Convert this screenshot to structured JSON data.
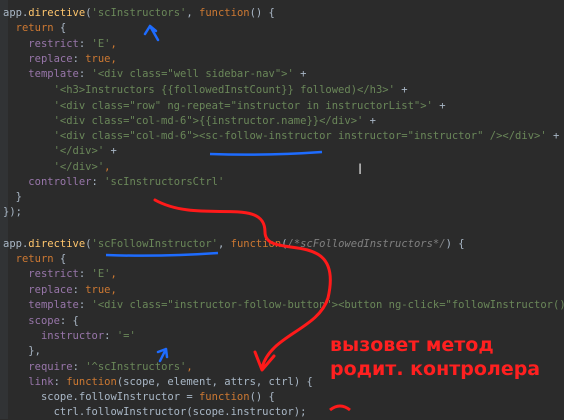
{
  "code_lines": [
    {
      "parts": [
        [
          "app.",
          "plain"
        ],
        [
          "directive",
          "fn"
        ],
        [
          "(",
          "plain"
        ],
        [
          "'scInstructors'",
          "str"
        ],
        [
          ", ",
          "plain"
        ],
        [
          "function",
          "kw"
        ],
        [
          "() {",
          "plain"
        ]
      ]
    },
    {
      "parts": [
        [
          "  ",
          "plain"
        ],
        [
          "return",
          "kw"
        ],
        [
          " {",
          "plain"
        ]
      ]
    },
    {
      "parts": [
        [
          "    ",
          "plain"
        ],
        [
          "restrict",
          "prop"
        ],
        [
          ": ",
          "plain"
        ],
        [
          "'E'",
          "str"
        ],
        [
          ",",
          "kw"
        ]
      ]
    },
    {
      "parts": [
        [
          "    ",
          "plain"
        ],
        [
          "replace",
          "prop"
        ],
        [
          ": ",
          "plain"
        ],
        [
          "true",
          "kw"
        ],
        [
          ",",
          "kw"
        ]
      ]
    },
    {
      "parts": [
        [
          "    ",
          "plain"
        ],
        [
          "template",
          "prop"
        ],
        [
          ": ",
          "plain"
        ],
        [
          "'<div class=\"well sidebar-nav\">'",
          "str"
        ],
        [
          " +",
          "plain"
        ]
      ]
    },
    {
      "parts": [
        [
          "        ",
          "plain"
        ],
        [
          "'<h3>Instructors {{followedInstCount}} followed)</h3>'",
          "str"
        ],
        [
          " +",
          "plain"
        ]
      ]
    },
    {
      "parts": [
        [
          "        ",
          "plain"
        ],
        [
          "'<div class=\"row\" ng-repeat=\"instructor in instructorList\">'",
          "str"
        ],
        [
          " +",
          "plain"
        ]
      ]
    },
    {
      "parts": [
        [
          "        ",
          "plain"
        ],
        [
          "'<div class=\"col-md-6\">{{instructor.name}}</div>'",
          "str"
        ],
        [
          " +",
          "plain"
        ]
      ]
    },
    {
      "parts": [
        [
          "        ",
          "plain"
        ],
        [
          "'<div class=\"col-md-6\"><sc-follow-instructor instructor=\"instructor\" /></div>'",
          "str"
        ],
        [
          " +",
          "plain"
        ]
      ]
    },
    {
      "parts": [
        [
          "        ",
          "plain"
        ],
        [
          "'</div>'",
          "str"
        ],
        [
          " +",
          "plain"
        ]
      ]
    },
    {
      "parts": [
        [
          "        ",
          "plain"
        ],
        [
          "'</div>'",
          "str"
        ],
        [
          ",",
          "kw"
        ]
      ]
    },
    {
      "parts": [
        [
          "    ",
          "plain"
        ],
        [
          "controller",
          "prop"
        ],
        [
          ": ",
          "plain"
        ],
        [
          "'scInstructorsCtrl'",
          "str"
        ]
      ]
    },
    {
      "parts": [
        [
          "  }",
          "plain"
        ]
      ]
    },
    {
      "parts": [
        [
          "});",
          "plain"
        ]
      ]
    },
    {
      "parts": [
        [
          "",
          "plain"
        ]
      ]
    },
    {
      "parts": [
        [
          "app.",
          "plain"
        ],
        [
          "directive",
          "fn"
        ],
        [
          "(",
          "plain"
        ],
        [
          "'scFollowInstructor'",
          "str"
        ],
        [
          ", ",
          "plain"
        ],
        [
          "function",
          "kw"
        ],
        [
          "(",
          "plain"
        ],
        [
          "/*scFollowedInstructors*/",
          "cmt"
        ],
        [
          ") {",
          "plain"
        ]
      ]
    },
    {
      "parts": [
        [
          "  ",
          "plain"
        ],
        [
          "return",
          "kw"
        ],
        [
          " {",
          "plain"
        ]
      ]
    },
    {
      "parts": [
        [
          "    ",
          "plain"
        ],
        [
          "restrict",
          "prop"
        ],
        [
          ": ",
          "plain"
        ],
        [
          "'E'",
          "str"
        ],
        [
          ",",
          "kw"
        ]
      ]
    },
    {
      "parts": [
        [
          "    ",
          "plain"
        ],
        [
          "replace",
          "prop"
        ],
        [
          ": ",
          "plain"
        ],
        [
          "true",
          "kw"
        ],
        [
          ",",
          "kw"
        ]
      ]
    },
    {
      "parts": [
        [
          "    ",
          "plain"
        ],
        [
          "template",
          "prop"
        ],
        [
          ": ",
          "plain"
        ],
        [
          "'<div class=\"instructor-follow-button\"><button ng-click=\"followInstructor()\"",
          "str"
        ]
      ]
    },
    {
      "parts": [
        [
          "    ",
          "plain"
        ],
        [
          "scope",
          "prop"
        ],
        [
          ": {",
          "plain"
        ]
      ]
    },
    {
      "parts": [
        [
          "      ",
          "plain"
        ],
        [
          "instructor",
          "prop"
        ],
        [
          ": ",
          "plain"
        ],
        [
          "'='",
          "str"
        ]
      ]
    },
    {
      "parts": [
        [
          "    },",
          "plain"
        ]
      ]
    },
    {
      "parts": [
        [
          "    ",
          "plain"
        ],
        [
          "require",
          "prop"
        ],
        [
          ": ",
          "plain"
        ],
        [
          "'^scInstructors'",
          "str"
        ],
        [
          ",",
          "kw"
        ]
      ]
    },
    {
      "parts": [
        [
          "    ",
          "plain"
        ],
        [
          "link",
          "prop"
        ],
        [
          ": ",
          "plain"
        ],
        [
          "function",
          "kw"
        ],
        [
          "(scope, element, attrs, ctrl) {",
          "plain"
        ]
      ]
    },
    {
      "parts": [
        [
          "      ",
          "plain"
        ],
        [
          "scope.followInstructor = ",
          "plain"
        ],
        [
          "function",
          "kw"
        ],
        [
          "() {",
          "plain"
        ]
      ]
    },
    {
      "parts": [
        [
          "        ctrl.followInstructor(scope.instructor);",
          "plain"
        ]
      ]
    }
  ],
  "annotation": {
    "line1": "вызовет метод",
    "line2": "родит. контролера"
  },
  "colors": {
    "background": "#2b2b2b",
    "keyword": "#cc7832",
    "function_name": "#ffc66d",
    "string": "#6a8759",
    "property": "#9876aa",
    "annotation_red": "#ff2020",
    "marker_blue": "#1e6cff"
  }
}
